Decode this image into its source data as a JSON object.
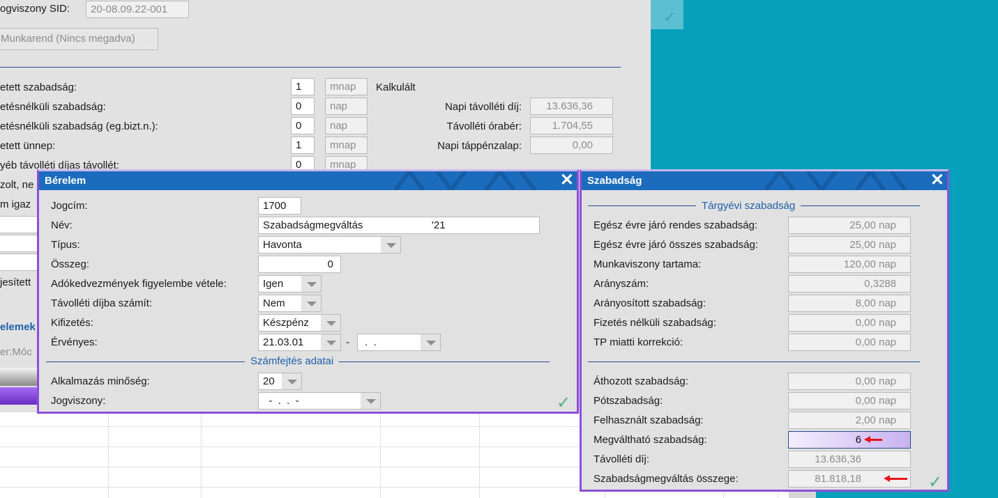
{
  "main": {
    "sid_label": "ogviszony SID:",
    "sid_value": "20-08.09.22-001",
    "munkarend_button": "Munkarend (Nincs megadva)",
    "rows": [
      {
        "label": "etett szabadság:",
        "value": "1",
        "unit": "mnap"
      },
      {
        "label": "etésnélküli szabadság:",
        "value": "0",
        "unit": "nap"
      },
      {
        "label": "etésnélküli szabadság (eg.bizt.n.):",
        "value": "0",
        "unit": "nap"
      },
      {
        "label": "etett ünnep:",
        "value": "1",
        "unit": "mnap"
      },
      {
        "label": "yéb távolléti díjas távollét:",
        "value": "0",
        "unit": "mnap"
      }
    ],
    "calc_title": "Kalkulált",
    "calc": [
      {
        "label": "Napi távolléti díj:",
        "value": "13.636,36"
      },
      {
        "label": "Távolléti órabér:",
        "value": "1.704,55"
      },
      {
        "label": "Napi táppénzalap:",
        "value": "0,00"
      }
    ],
    "partial": [
      "zolt, ne",
      "m igaz",
      "jesített",
      "elemek",
      "er:Móc"
    ]
  },
  "berelem": {
    "title": "Bérelem",
    "jogcim_label": "Jogcím:",
    "jogcim": "1700",
    "nev_label": "Név:",
    "nev": "Szabadságmegváltás",
    "nev_suffix": "'21",
    "tipus_label": "Típus:",
    "tipus": "Havonta",
    "osszeg_label": "Összeg:",
    "osszeg": "0",
    "ado_label": "Adókedvezmények figyelembe vétele:",
    "ado": "Igen",
    "tavol_label": "Távolléti díjba számít:",
    "tavol": "Nem",
    "kifiz_label": "Kifizetés:",
    "kifiz": "Készpénz",
    "erv_label": "Érvényes:",
    "erv_from": "21.03.01",
    "erv_dash": "-",
    "erv_to": " .  .",
    "section": "Számfejtés adatai",
    "alk_label": "Alkalmazás minőség:",
    "alk": "20",
    "jogv_label": "Jogviszony:",
    "jogv": "  -  .  .  -"
  },
  "szabadsag": {
    "title": "Szabadság",
    "section": "Tárgyévi szabadság",
    "rows1": [
      {
        "label": "Egész évre járó rendes szabadság:",
        "value": "25,00 nap"
      },
      {
        "label": "Egész évre járó összes szabadság:",
        "value": "25,00 nap"
      },
      {
        "label": "Munkaviszony tartama:",
        "value": "120,00 nap"
      },
      {
        "label": "Arányszám:",
        "value": "0,3288"
      },
      {
        "label": "Arányosított szabadság:",
        "value": "8,00 nap"
      },
      {
        "label": "Fizetés nélküli szabadság:",
        "value": "0,00 nap"
      },
      {
        "label": "TP miatti korrekció:",
        "value": "0,00 nap"
      }
    ],
    "rows2": [
      {
        "label": "Áthozott szabadság:",
        "value": "0,00 nap"
      },
      {
        "label": "Pótszabadság:",
        "value": "0,00 nap"
      },
      {
        "label": "Felhasznált szabadság:",
        "value": "2,00 nap"
      },
      {
        "label": "Megváltható szabadság:",
        "value": "6"
      },
      {
        "label": "Távolléti díj:",
        "value": "13.636,36"
      },
      {
        "label": "Szabadságmegváltás összege:",
        "value": "81.818,18"
      }
    ]
  },
  "colors": {
    "accent": "#1b6cbd",
    "dialog_border": "#8b4fd8",
    "background": "#06a0bb",
    "annotation": "#e8141c"
  }
}
